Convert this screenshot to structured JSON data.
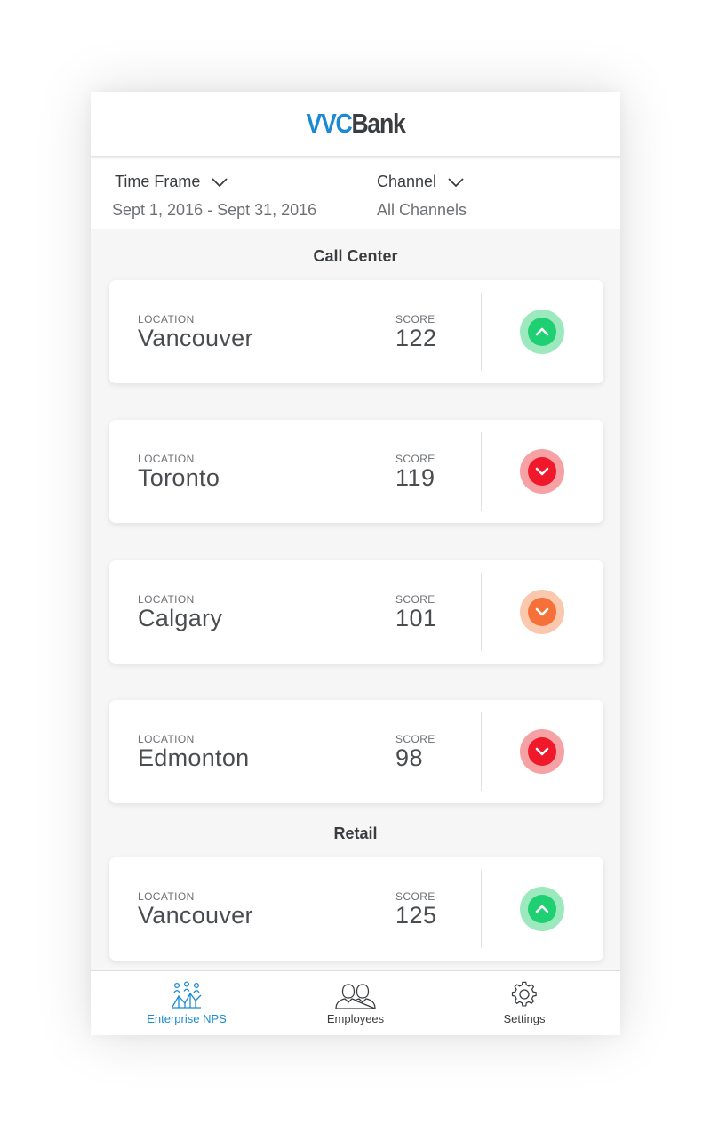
{
  "brand": {
    "part1": "VVC",
    "part2": "Bank",
    "color1": "#1a8ad5",
    "color2": "#3a3d40"
  },
  "filters": {
    "time_frame": {
      "label": "Time Frame",
      "value": "Sept 1, 2016 -  Sept 31, 2016",
      "icon": "chevron-down-icon"
    },
    "channel": {
      "label": "Channel",
      "value": "All Channels",
      "icon": "chevron-down-icon"
    }
  },
  "sections": [
    {
      "title": "Call Center",
      "cards": [
        {
          "location_caption": "LOCATION",
          "location": "Vancouver",
          "score_caption": "SCORE",
          "score": "122",
          "trend": "up",
          "trend_color": "#1ed071",
          "trend_halo": "#9be9bd",
          "icon": "chevron-up-icon"
        },
        {
          "location_caption": "LOCATION",
          "location": "Toronto",
          "score_caption": "SCORE",
          "score": "119",
          "trend": "down",
          "trend_color": "#f0182b",
          "trend_halo": "#f6a1a4",
          "icon": "chevron-down-icon"
        },
        {
          "location_caption": "LOCATION",
          "location": "Calgary",
          "score_caption": "SCORE",
          "score": "101",
          "trend": "down",
          "trend_color": "#f6713a",
          "trend_halo": "#f9c8ad",
          "icon": "chevron-down-icon"
        },
        {
          "location_caption": "LOCATION",
          "location": "Edmonton",
          "score_caption": "SCORE",
          "score": "98",
          "trend": "down",
          "trend_color": "#f0182b",
          "trend_halo": "#f6a1a4",
          "icon": "chevron-down-icon"
        }
      ]
    },
    {
      "title": "Retail",
      "cards": [
        {
          "location_caption": "LOCATION",
          "location": "Vancouver",
          "score_caption": "SCORE",
          "score": "125",
          "trend": "up",
          "trend_color": "#1ed071",
          "trend_halo": "#9be9bd",
          "icon": "chevron-up-icon"
        }
      ]
    }
  ],
  "tabbar": {
    "items": [
      {
        "label": "Enterprise NPS",
        "icon": "enterprise-nps-icon",
        "active": true,
        "color": "#1a8ad5"
      },
      {
        "label": "Employees",
        "icon": "employees-icon",
        "active": false,
        "color": "#3a3d40"
      },
      {
        "label": "Settings",
        "icon": "gear-icon",
        "active": false,
        "color": "#3a3d40"
      }
    ]
  }
}
